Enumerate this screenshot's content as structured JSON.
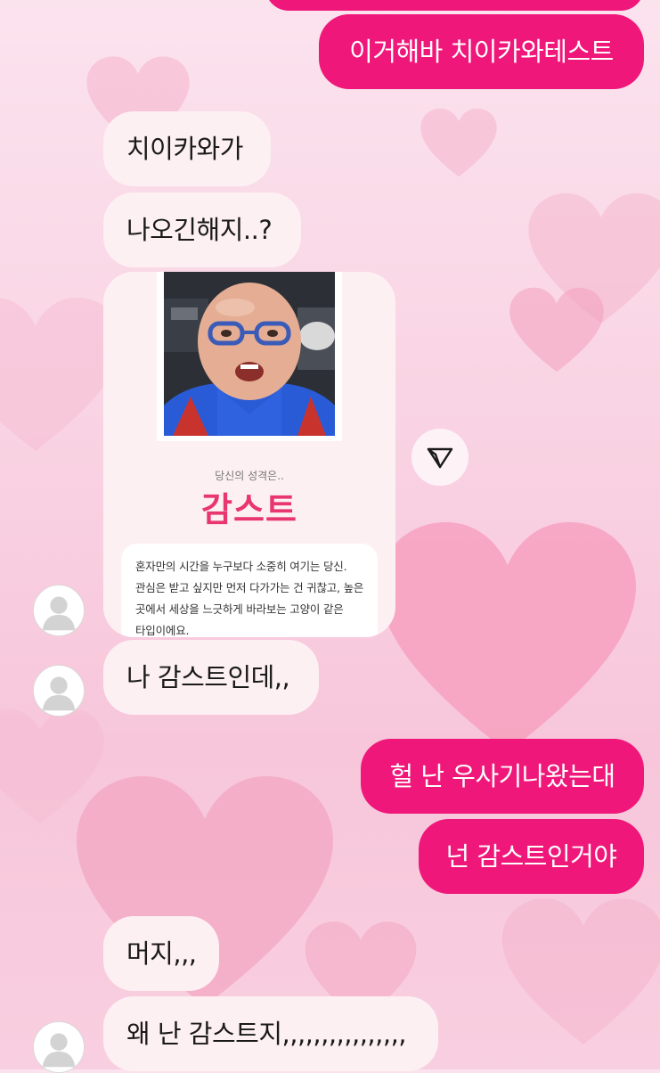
{
  "colors": {
    "incoming_bubble": "#fdf0f3",
    "outgoing_bubble": "#f0177a",
    "result_title": "#e8366f"
  },
  "messages": {
    "top_partial": "",
    "out_1": "이거해바 치이카와테스트",
    "in_1": "치이카와가",
    "in_2": "나오긴해지..?",
    "in_3": "나 감스트인데,,",
    "out_2": "헐 난 우사기나왔는대",
    "out_3": "넌 감스트인거야",
    "in_4": "머지,,,",
    "in_5": "왜 난 감스트지,,,,,,,,,,,,,,,,"
  },
  "result_card": {
    "subtitle": "당신의 성격은..",
    "result": "감스트",
    "description": "혼자만의 시간을 누구보다 소중히 여기는 당신. 관심은 받고 싶지만 먼저 다가가는 건 귀찮고, 높은 곳에서 세상을 느긋하게 바라보는 고양이 같은 타입이에요."
  },
  "icons": {
    "share": "share-send-icon",
    "avatar": "default-profile-icon"
  }
}
